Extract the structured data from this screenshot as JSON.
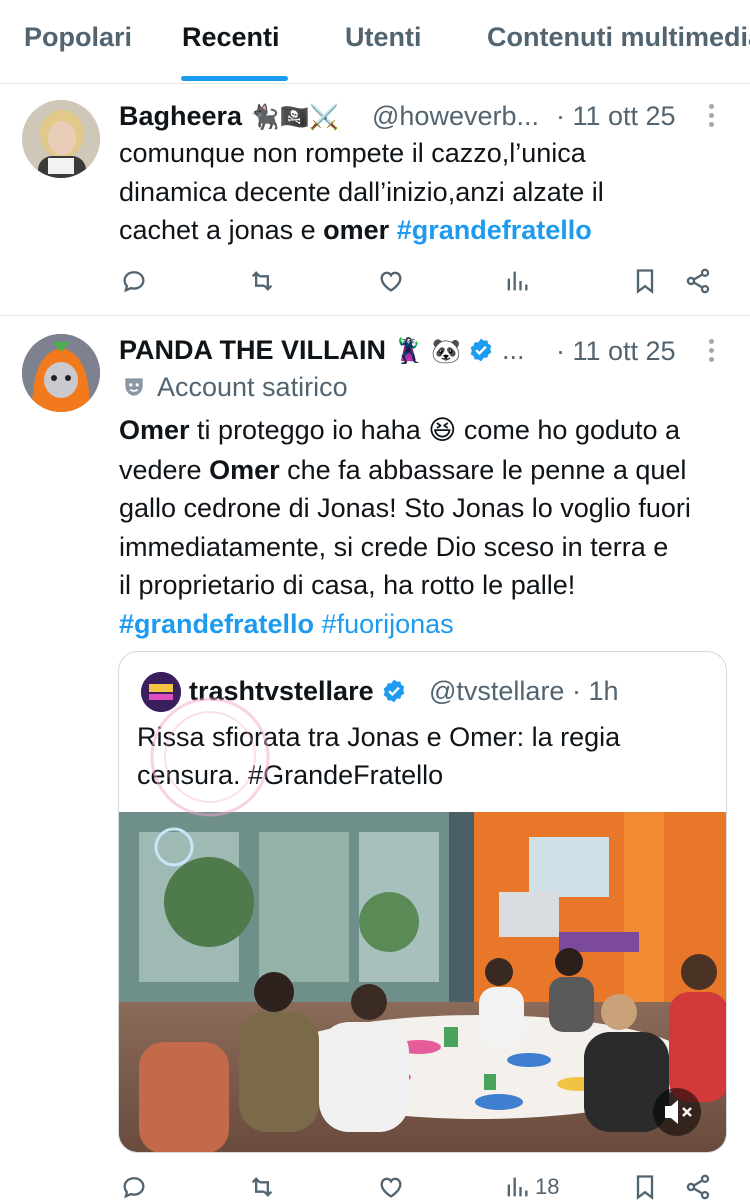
{
  "tabs": [
    {
      "label": "Popolari",
      "active": false
    },
    {
      "label": "Recenti",
      "active": true
    },
    {
      "label": "Utenti",
      "active": false
    },
    {
      "label": "Contenuti multimedia",
      "active": false
    }
  ],
  "posts": [
    {
      "name": "Bagheera",
      "name_emojis": "🐈‍⬛🏴‍☠️⚔️",
      "handle": "@howeverb...",
      "time": "· 11 ott 25",
      "text_lines": [
        "comunque non rompete il cazzo,l’unica",
        "dinamica decente dall’inizio,anzi alzate il",
        "cachet a jonas e "
      ],
      "bold_word": "omer",
      "hashtag": "#grandefratello"
    },
    {
      "name": "PANDA THE VILLAIN",
      "name_emojis": "🦹‍♀️ 🐼",
      "ellipsis": "...",
      "time": "· 11 ott 25",
      "label": "Account satirico",
      "bold1": "Omer",
      "line1_rest": " ti proteggo io haha ",
      "line1_emoji": "😆",
      "line1_end": " come ho goduto a",
      "line2_start": "vedere ",
      "bold2": "Omer",
      "line2_rest": " che fa abbassare le penne a quel",
      "line3": "gallo cedrone di Jonas! Sto Jonas lo voglio fuori",
      "line4": "immediatamente, si crede Dio sceso in terra e",
      "line5": "il proprietario di casa, ha rotto le palle!",
      "hashtag1": "#grandefratello",
      "hashtag2": "#fuorijonas",
      "views": "18",
      "quote": {
        "name": "trashtvstellare",
        "handle": "@tvstellare · 1h",
        "text_line1": "Rissa sfiorata tra Jonas e Omer: la regia",
        "text_line2": "censura. #GrandeFratello"
      }
    }
  ],
  "colors": {
    "accent": "#1d9bf0",
    "text": "#0f1419",
    "muted": "#536471",
    "border": "#e6e9ea"
  },
  "icons": [
    "reply-icon",
    "retweet-icon",
    "like-icon",
    "views-icon",
    "bookmark-icon",
    "share-icon",
    "verified-icon",
    "mask-icon",
    "more-icon",
    "mute-icon"
  ]
}
